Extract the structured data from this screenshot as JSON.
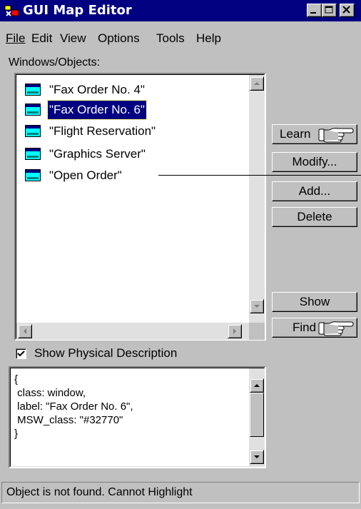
{
  "window": {
    "title": "GUI Map Editor"
  },
  "menu": {
    "items": [
      {
        "label": "File"
      },
      {
        "label": "Edit"
      },
      {
        "label": "View"
      },
      {
        "label": "Options"
      },
      {
        "label": "Tools"
      },
      {
        "label": "Help"
      }
    ]
  },
  "objects_label": "Windows/Objects:",
  "objects": [
    {
      "label": "\"Fax Order No. 4\"",
      "selected": false
    },
    {
      "label": "\"Fax Order No. 6\"",
      "selected": true
    },
    {
      "label": "\"Flight Reservation\"",
      "selected": false
    },
    {
      "label": "\"Graphics Server\"",
      "selected": false
    },
    {
      "label": "\"Open Order\"",
      "selected": false
    }
  ],
  "buttons": {
    "learn": "Learn",
    "modify": "Modify...",
    "add": "Add...",
    "delete": "Delete",
    "show": "Show",
    "find": "Find"
  },
  "physical_description": {
    "checkbox_label": "Show Physical Description",
    "checked": true,
    "lines": [
      "{",
      " class: window,",
      " label: \"Fax Order No. 6\",",
      " MSW_class: \"#32770\"",
      "}"
    ]
  },
  "status": {
    "text": "Object is not found. Cannot Highlight"
  },
  "colors": {
    "title_bar": "#000080",
    "selection": "#000080",
    "face": "#c0c0c0"
  },
  "icons": [
    "app-icon",
    "minimize-icon",
    "maximize-icon",
    "close-icon",
    "window-object-icon",
    "pointing-hand-icon"
  ]
}
